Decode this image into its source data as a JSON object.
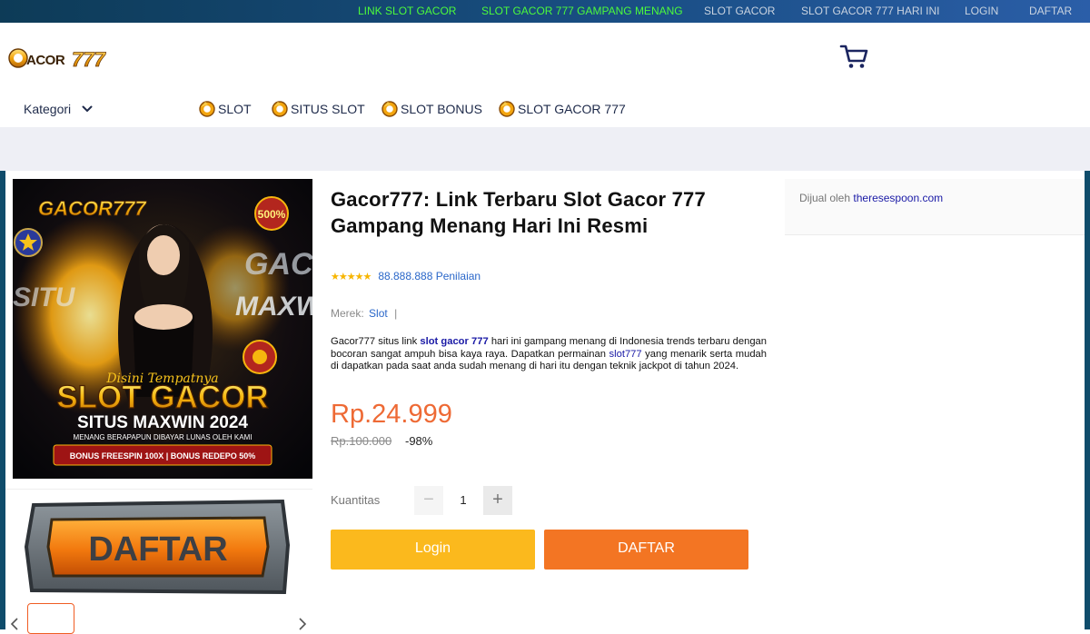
{
  "topbar": {
    "links": [
      "LINK SLOT GACOR",
      "SLOT GACOR 777 GAMPANG MENANG",
      "SLOT GACOR",
      "SLOT GACOR 777 HARI INI",
      "LOGIN",
      "DAFTAR"
    ],
    "colors": {
      "highlight": "#4cfa3c",
      "muted": "#c9d3e0"
    }
  },
  "header": {
    "logo_text": "GACOR777",
    "kategori_label": "Kategori",
    "nav": [
      "SLOT",
      "SITUS SLOT",
      "SLOT BONUS",
      "SLOT GACOR 777"
    ]
  },
  "gallery": {
    "banner": {
      "brand": "GACOR777",
      "tagline": "Disini Tempatnya",
      "headline": "SLOT GACOR",
      "subheadline": "SITUS MAXWIN 2024",
      "slogan": "MENANG BERAPAPUN DIBAYAR LUNAS OLEH KAMI",
      "bonus_strip": "BONUS FREESPIN 100X | BONUS REDEPO 50%",
      "badge": "500%"
    },
    "daftar_image_text": "DAFTAR"
  },
  "product": {
    "title": "Gacor777: Link Terbaru Slot Gacor 777 Gampang Menang Hari Ini Resmi",
    "rating_stars": "★★★★★",
    "rating_text": "88.888.888 Penilaian",
    "brand_label": "Merek:",
    "brand_value": "Slot",
    "brand_sep": "|",
    "description": {
      "p1": "Gacor777 situs link ",
      "link1": "slot gacor 777",
      "p2": " hari ini gampang menang di Indonesia trends terbaru dengan bocoran sangat ampuh bisa kaya raya. Dapatkan permainan ",
      "link2": "slot777",
      "p3": " yang menarik serta mudah di dapatkan pada saat anda sudah menang di hari itu dengan teknik jackpot di tahun 2024."
    },
    "price": "Rp.24.999",
    "old_price": "Rp.100.000",
    "discount": "-98%",
    "quantity_label": "Kuantitas",
    "quantity_value": "1",
    "minus_symbol": "−",
    "plus_symbol": "+",
    "login_button": "Login",
    "daftar_button": "DAFTAR",
    "colors": {
      "price": "#ee6a35",
      "login": "#fbb91d",
      "daftar": "#f37523"
    }
  },
  "seller": {
    "label": "Dijual oleh",
    "name": "theresespoon.com"
  },
  "icons": [
    "cart-icon",
    "chevron-down-icon",
    "coin-icon",
    "chevron-left-icon",
    "chevron-right-icon"
  ]
}
